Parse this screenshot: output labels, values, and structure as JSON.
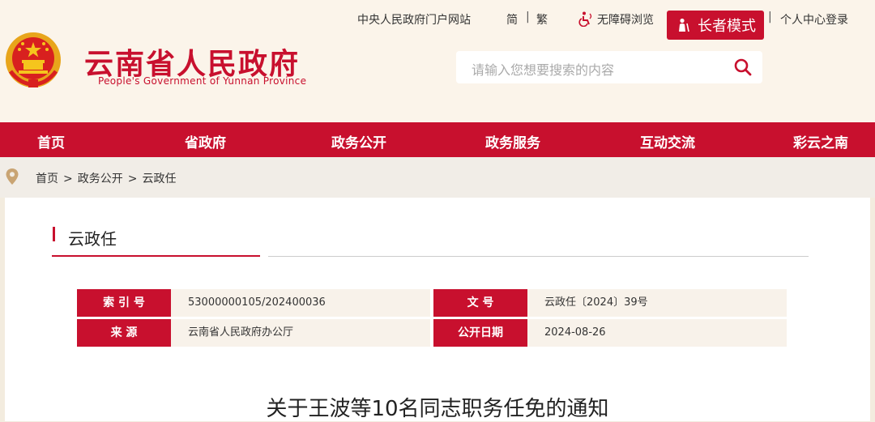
{
  "header": {
    "top_links": {
      "portal": "中央人民政府门户网站",
      "simplified": "简",
      "traditional": "繁",
      "accessibility": "无障碍浏览",
      "elder_mode": "长者模式",
      "login": "个人中心登录",
      "sep": "|"
    },
    "title": "云南省人民政府",
    "subtitle": "People's Government of Yunnan Province",
    "search": {
      "placeholder": "请输入您想要搜索的内容"
    }
  },
  "nav": {
    "items": [
      {
        "label": "首页"
      },
      {
        "label": "省政府"
      },
      {
        "label": "政务公开"
      },
      {
        "label": "政务服务"
      },
      {
        "label": "互动交流"
      },
      {
        "label": "彩云之南"
      }
    ]
  },
  "breadcrumb": {
    "items": [
      "首页",
      "政务公开",
      "云政任"
    ],
    "sep": ">"
  },
  "section": {
    "title": "云政任"
  },
  "meta": {
    "index_label": "索 引 号",
    "index_value": "53000000105/202400036",
    "doc_no_label": "文    号",
    "doc_no_value": "云政任〔2024〕39号",
    "source_label": "来    源",
    "source_value": "云南省人民政府办公厅",
    "date_label": "公开日期",
    "date_value": "2024-08-26"
  },
  "article": {
    "title": "关于王波等10名同志职务任免的通知"
  },
  "colors": {
    "brand_red": "#c8102e",
    "header_bg": "#fbf4ea",
    "meta_bg": "#f8f2ea"
  }
}
